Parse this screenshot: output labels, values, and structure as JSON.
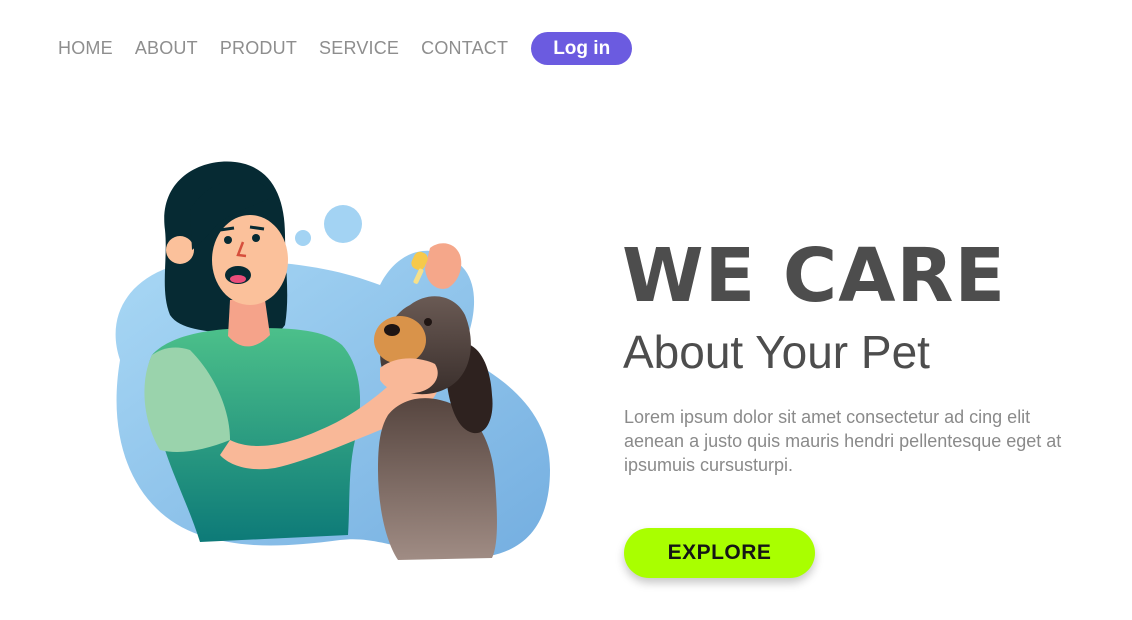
{
  "nav": {
    "items": [
      {
        "label": "HOME"
      },
      {
        "label": "ABOUT"
      },
      {
        "label": "PRODUT"
      },
      {
        "label": "SERVICE"
      },
      {
        "label": "CONTACT"
      }
    ],
    "login_label": "Log in"
  },
  "hero": {
    "title": "WE CARE",
    "subtitle": "About Your Pet",
    "body": "Lorem ipsum dolor sit amet consectetur ad cing elit aenean a justo quis mauris hendri pellentesque eget at ipsumuis cursusturpi.",
    "button_label": "EXPLORE"
  },
  "illustration": {
    "subject": "woman applying drops to a dog"
  },
  "colors": {
    "nav_text": "#8e8e8e",
    "login_bg": "#6b5be0",
    "headline": "#4d4d4d",
    "body_text": "#8a8a8a",
    "explore_bg": "#a9ff00",
    "blob": "#8fc6ec"
  }
}
